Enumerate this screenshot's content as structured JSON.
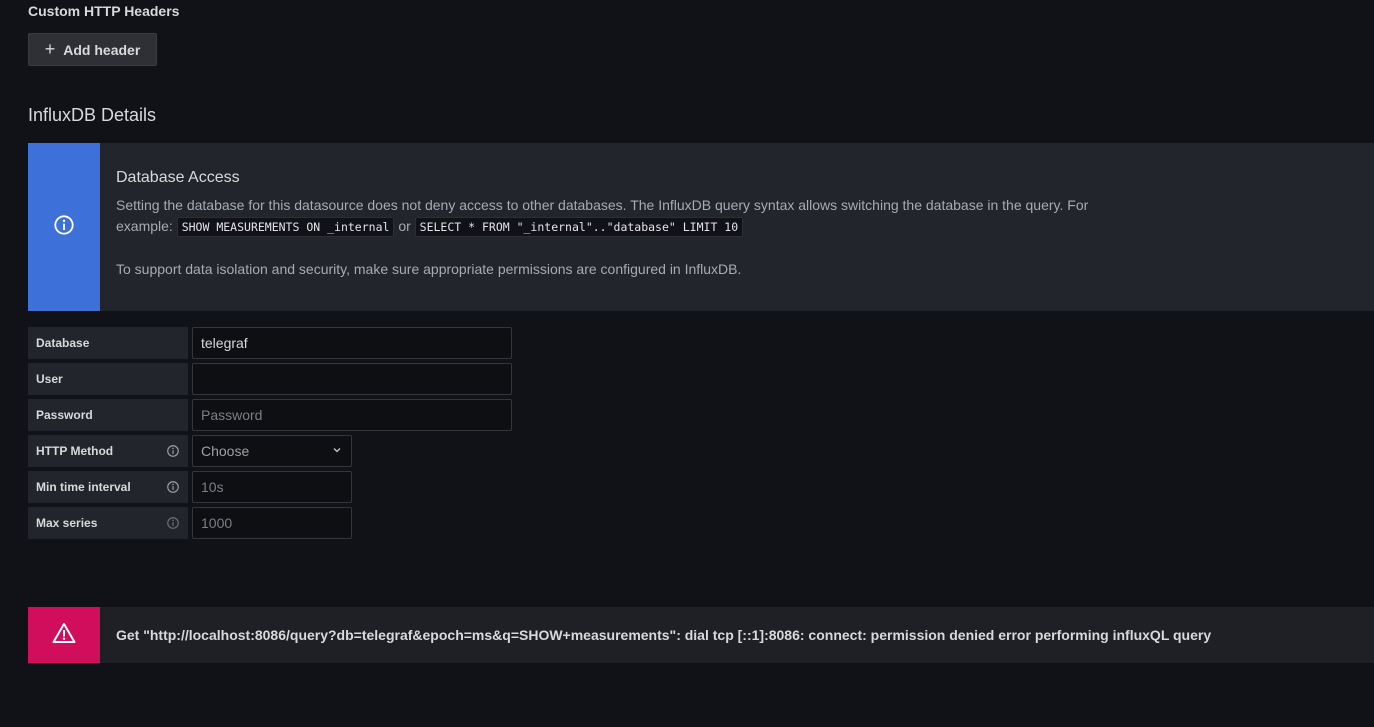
{
  "custom_headers": {
    "title": "Custom HTTP Headers",
    "add_label": "Add header"
  },
  "influx": {
    "title": "InfluxDB Details"
  },
  "info_alert": {
    "title": "Database Access",
    "text_1a": "Setting the database for this datasource does not deny access to other databases. The InfluxDB query syntax allows switching the database in the query. For example:",
    "code_1": "SHOW MEASUREMENTS ON _internal",
    "or_word": "or",
    "code_2": "SELECT * FROM \"_internal\"..\"database\" LIMIT 10",
    "text_2": "To support data isolation and security, make sure appropriate permissions are configured in InfluxDB."
  },
  "fields": {
    "database": {
      "label": "Database",
      "value": "telegraf"
    },
    "user": {
      "label": "User",
      "value": ""
    },
    "password": {
      "label": "Password",
      "placeholder": "Password"
    },
    "http_method": {
      "label": "HTTP Method",
      "selected": "Choose"
    },
    "min_time": {
      "label": "Min time interval",
      "placeholder": "10s"
    },
    "max_series": {
      "label": "Max series",
      "placeholder": "1000"
    }
  },
  "error_alert": {
    "text": "Get \"http://localhost:8086/query?db=telegraf&epoch=ms&q=SHOW+measurements\": dial tcp [::1]:8086: connect: permission denied error performing influxQL query"
  },
  "colors": {
    "info_accent": "#3d71d9",
    "error_accent": "#d10e5c",
    "background": "#111217"
  },
  "icons": {
    "add": "plus-icon",
    "info": "info-circle-icon",
    "warning": "warning-triangle-icon",
    "dropdown": "chevron-down-icon"
  }
}
